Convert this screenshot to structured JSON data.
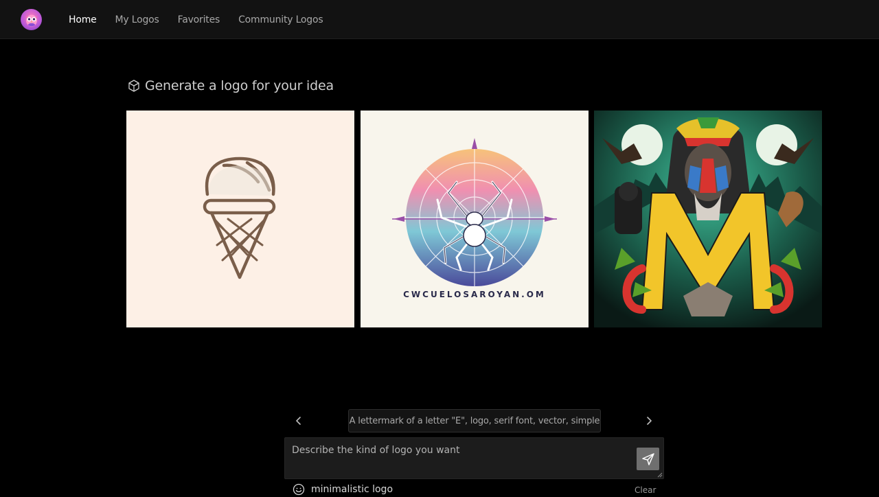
{
  "nav": {
    "brand_icon": "owl-logo-icon",
    "items": [
      {
        "label": "Home",
        "active": true
      },
      {
        "label": "My Logos",
        "active": false
      },
      {
        "label": "Favorites",
        "active": false
      },
      {
        "label": "Community Logos",
        "active": false
      }
    ]
  },
  "hero": {
    "icon": "cube-icon",
    "title": "Generate a logo for your idea"
  },
  "gallery": {
    "cards": [
      {
        "subject": "ice cream cone line logo"
      },
      {
        "subject": "spider on geometric web emblem",
        "caption": "CWCUELOSAROYAN.OM"
      },
      {
        "subject": "mandrill letter M illustration"
      }
    ]
  },
  "suggestion": {
    "text": "A lettermark of a letter \"E\", logo, serif font, vector, simple",
    "prev_icon": "chevron-left-icon",
    "next_icon": "chevron-right-icon"
  },
  "prompt": {
    "placeholder": "Describe the kind of logo you want",
    "value": "",
    "send_icon": "paper-plane-icon"
  },
  "style": {
    "icon": "smile-icon",
    "label": "minimalistic logo",
    "clear_label": "Clear"
  },
  "colors": {
    "background": "#000000",
    "topbar": "#121212",
    "send_button": "#6f6f6f"
  }
}
